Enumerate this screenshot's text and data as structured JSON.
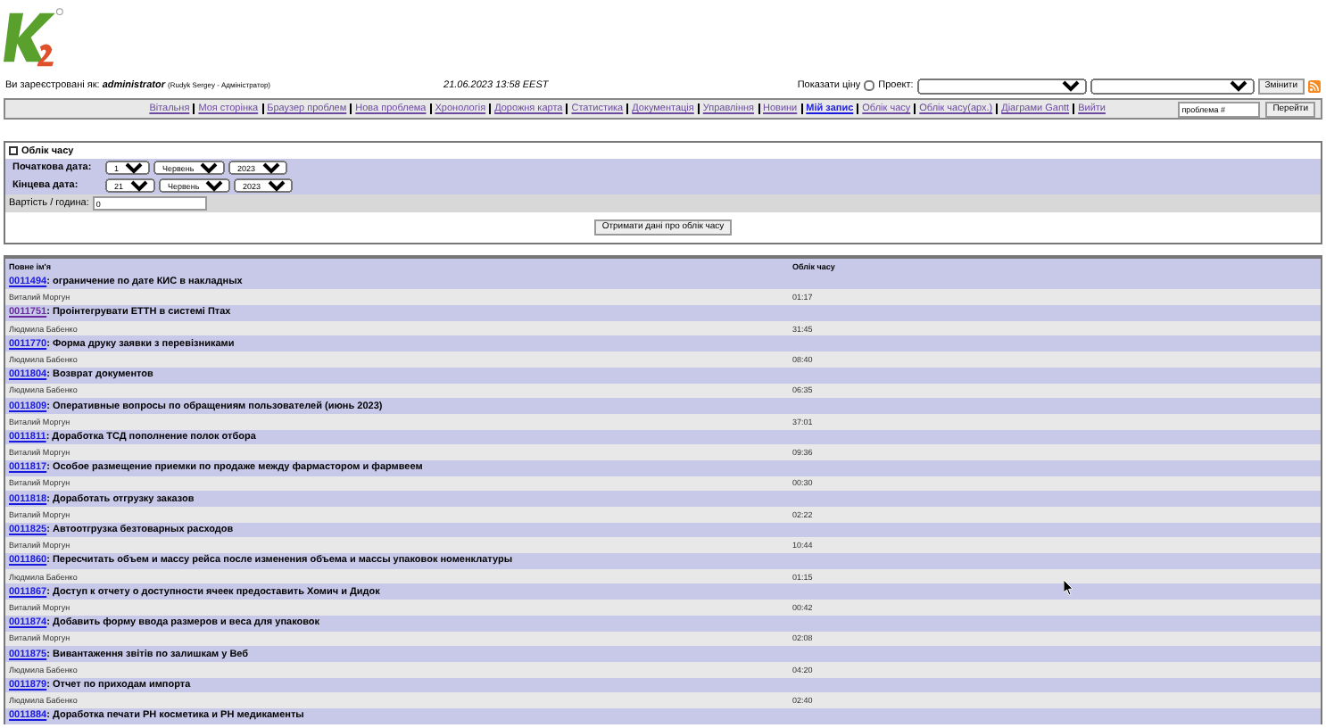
{
  "header": {
    "login_label": "Ви зареєстровані як:",
    "username": "administrator",
    "user_detail": "(Rudyk Sergey - Адміністратор)",
    "datetime": "21.06.2023 13:58 EEST",
    "show_price_label": "Показати ціну",
    "show_price_checked": false,
    "project_label": "Проект:",
    "change_button": "Змінити"
  },
  "menu": [
    {
      "label": "Вітальня",
      "selected": false
    },
    {
      "label": "Моя сторінка",
      "selected": false
    },
    {
      "label": "Браузер проблем",
      "selected": false
    },
    {
      "label": "Нова проблема",
      "selected": false
    },
    {
      "label": "Хронологія",
      "selected": false
    },
    {
      "label": "Дорожня карта",
      "selected": false
    },
    {
      "label": "Статистика",
      "selected": false
    },
    {
      "label": "Документація",
      "selected": false
    },
    {
      "label": "Управління",
      "selected": false
    },
    {
      "label": "Новини",
      "selected": false
    },
    {
      "label": "Мій запис",
      "selected": true
    },
    {
      "label": "Облік часу",
      "selected": false
    },
    {
      "label": "Облік часу(арх.)",
      "selected": false
    },
    {
      "label": "Діаграми Gantt",
      "selected": false
    },
    {
      "label": "Вийти",
      "selected": false
    }
  ],
  "jump": {
    "value": "проблема #",
    "button": "Перейти"
  },
  "panel": {
    "title": "Облік часу",
    "start_label": "Початкова дата:",
    "start": {
      "day": "1",
      "month": "Червень",
      "year": "2023"
    },
    "end_label": "Кінцева дата:",
    "end": {
      "day": "21",
      "month": "Червень",
      "year": "2023"
    },
    "rate_label": "Вартість / година:",
    "rate_value": "0",
    "submit": "Отримати дані про облік часу"
  },
  "table": {
    "columns": [
      "Повне ім'я",
      "Облік часу"
    ],
    "rows": [
      {
        "id": "0011494",
        "visited": false,
        "title": ": ограничение по дате КИС в накладных",
        "user": "Виталий Моргун",
        "time": "01:17"
      },
      {
        "id": "0011751",
        "visited": true,
        "title": ": Проінтегрувати ЕТТН в системі Птах",
        "user": "Людмила Бабенко",
        "time": "31:45"
      },
      {
        "id": "0011770",
        "visited": false,
        "title": ": Форма друку заявки з перевізниками",
        "user": "Людмила Бабенко",
        "time": "08:40"
      },
      {
        "id": "0011804",
        "visited": false,
        "title": ": Возврат документов",
        "user": "Людмила Бабенко",
        "time": "06:35"
      },
      {
        "id": "0011809",
        "visited": false,
        "title": ": Оперативные вопросы по обращениям пользователей (июнь 2023)",
        "user": "Виталий Моргун",
        "time": "37:01"
      },
      {
        "id": "0011811",
        "visited": false,
        "title": ": Доработка ТСД пополнение полок отбора",
        "user": "Виталий Моргун",
        "time": "09:36"
      },
      {
        "id": "0011817",
        "visited": false,
        "title": ": Особое размещение приемки по продаже между фармастором и фармвеем",
        "user": "Виталий Моргун",
        "time": "00:30"
      },
      {
        "id": "0011818",
        "visited": false,
        "title": ": Доработать отгрузку заказов",
        "user": "Виталий Моргун",
        "time": "02:22"
      },
      {
        "id": "0011825",
        "visited": false,
        "title": ": Автоотгрузка безтоварных расходов",
        "user": "Виталий Моргун",
        "time": "10:44"
      },
      {
        "id": "0011860",
        "visited": false,
        "title": ": Пересчитать объем и массу рейса после изменения объема и массы упаковок номенклатуры",
        "user": "Людмила Бабенко",
        "time": "01:15"
      },
      {
        "id": "0011867",
        "visited": false,
        "title": ": Доступ к отчету о доступности ячеек предоставить Хомич и Дидок",
        "user": "Виталий Моргун",
        "time": "00:42"
      },
      {
        "id": "0011874",
        "visited": false,
        "title": ": Добавить форму ввода размеров и веса для упаковок",
        "user": "Виталий Моргун",
        "time": "02:08"
      },
      {
        "id": "0011875",
        "visited": false,
        "title": ": Вивантаження звітів по залишкам у Веб",
        "user": "Людмила Бабенко",
        "time": "04:20"
      },
      {
        "id": "0011879",
        "visited": false,
        "title": ": Отчет по приходам импорта",
        "user": "Людмила Бабенко",
        "time": "02:40"
      },
      {
        "id": "0011884",
        "visited": false,
        "title": ": Доработка печати РН косметика и РН медикаменты"
      }
    ]
  }
}
